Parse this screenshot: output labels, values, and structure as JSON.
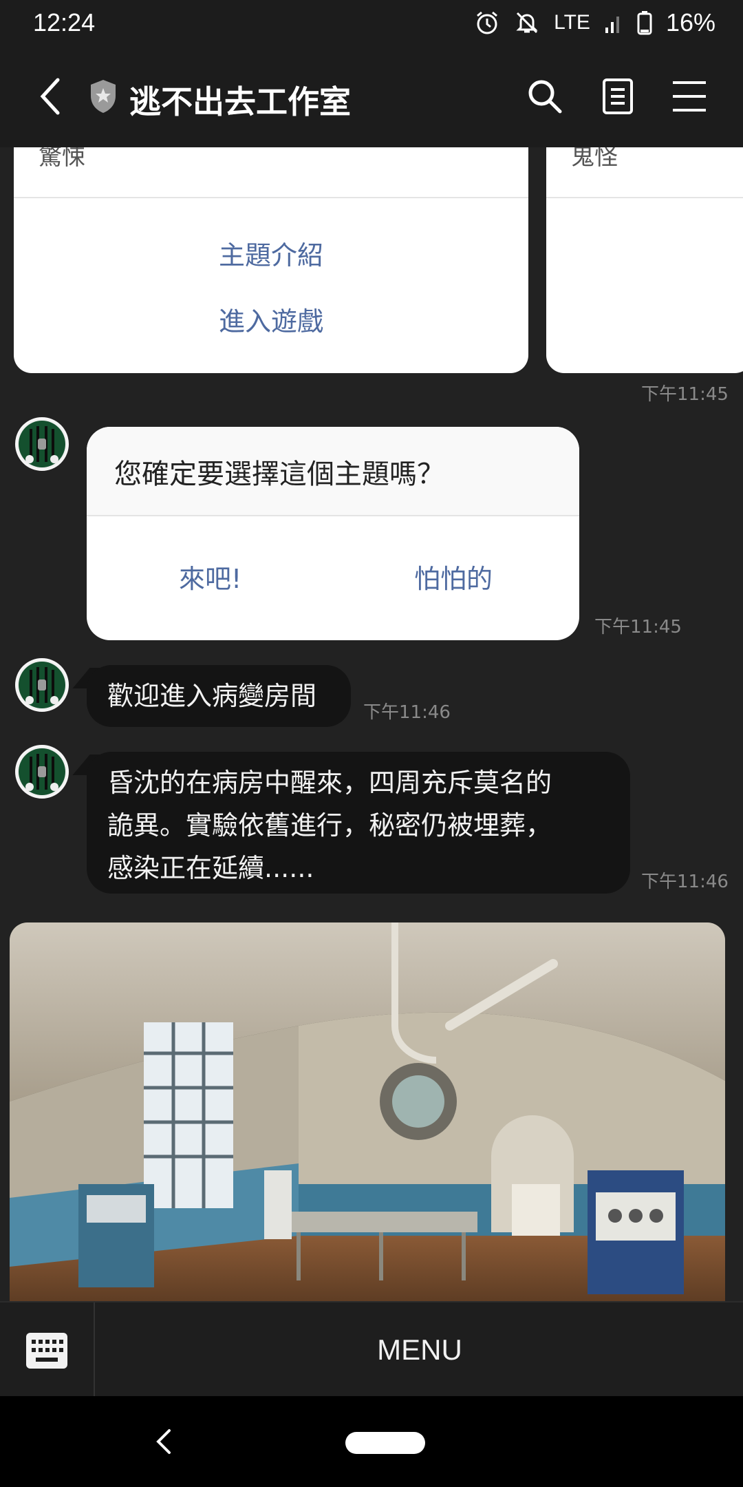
{
  "status_bar": {
    "time": "12:24",
    "network": "LTE",
    "battery": "16%"
  },
  "header": {
    "title": "逃不出去工作室",
    "icons": [
      "back-icon",
      "shield-icon",
      "search-icon",
      "notes-icon",
      "menu-icon"
    ]
  },
  "carousel": {
    "cards": [
      {
        "cut_text": "驚悚",
        "actions": [
          "主題介紹",
          "進入遊戲"
        ]
      },
      {
        "cut_text": "鬼怪"
      }
    ],
    "time": "下午11:45"
  },
  "messages": [
    {
      "type": "confirm",
      "question": "您確定要選擇這個主題嗎？",
      "options": [
        "來吧!",
        "怕怕的"
      ],
      "time": "下午11:45"
    },
    {
      "type": "text",
      "text": "歡迎進入病變房間",
      "time": "下午11:46"
    },
    {
      "type": "text",
      "lines": [
        "昏沈的在病房中醒來，四周充斥莫名的",
        "詭異。實驗依舊進行，秘密仍被埋葬，",
        "感染正在延續......"
      ],
      "time": "下午11:46"
    },
    {
      "type": "image",
      "description_icon": "abandoned-hospital-room-photo"
    }
  ],
  "menu_bar": {
    "menu_label": "MENU"
  },
  "colors": {
    "background": "#222222",
    "header": "#1c1c1c",
    "bubble": "#141414",
    "link": "#4e6aa0",
    "timestamp": "#8a8a8a"
  }
}
